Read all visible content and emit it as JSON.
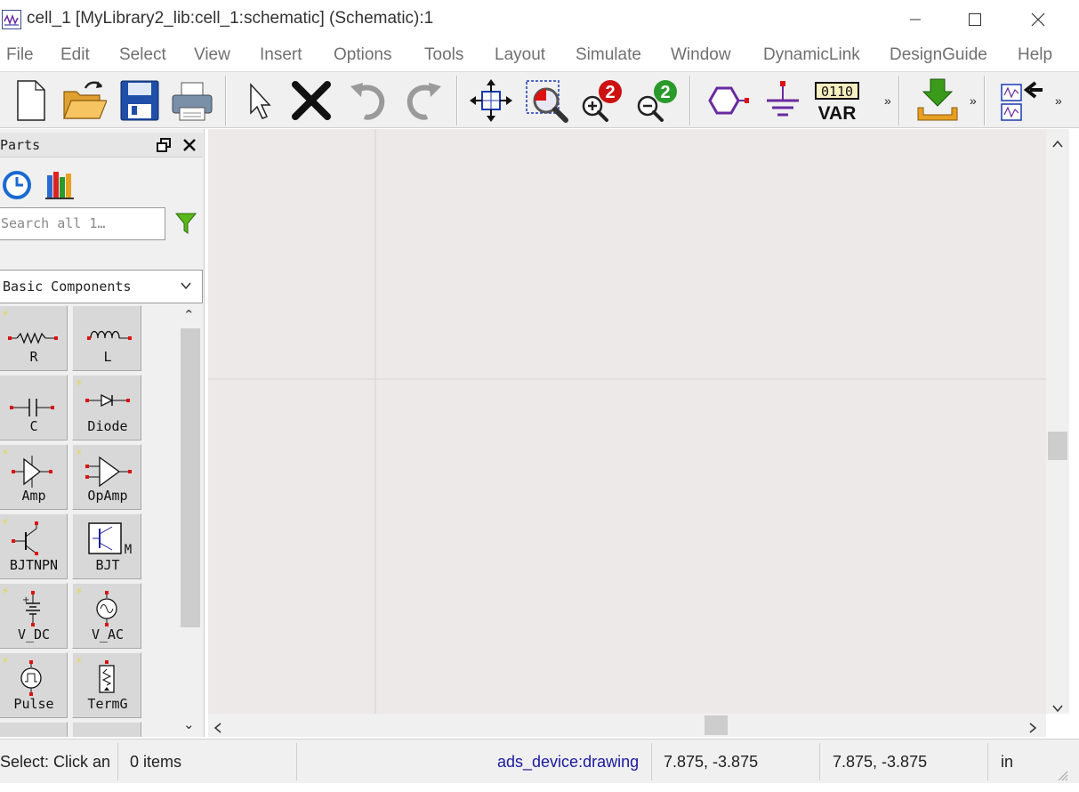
{
  "window": {
    "title": "cell_1 [MyLibrary2_lib:cell_1:schematic] (Schematic):1",
    "controls": [
      "minimize",
      "maximize",
      "close"
    ]
  },
  "menu": [
    "File",
    "Edit",
    "Select",
    "View",
    "Insert",
    "Options",
    "Tools",
    "Layout",
    "Simulate",
    "Window",
    "DynamicLink",
    "DesignGuide",
    "Help"
  ],
  "toolbar": {
    "buttons": [
      "new-document-icon",
      "open-folder-icon",
      "save-icon",
      "print-icon",
      "select-pointer-icon",
      "delete-icon",
      "undo-icon",
      "redo-icon",
      "pan-view-icon",
      "zoom-area-icon",
      "zoom-in-icon",
      "zoom-out-icon",
      "port-icon",
      "ground-icon",
      "var-icon",
      "simulate-icon",
      "component-palette-icon"
    ],
    "var_top": "0110",
    "var_bottom": "VAR",
    "zoom_in_digit": "2",
    "zoom_out_digit": "2",
    "colors": {
      "port": "#6a2aa0",
      "ground": "#6a2aa0",
      "simulate": "#3a8a1a",
      "zoom_badge": "#cc1111"
    }
  },
  "parts_panel": {
    "title": "Parts",
    "search_placeholder": "Search all 1…",
    "library": "Basic Components",
    "parts": [
      {
        "label": "R",
        "symbol": "resistor"
      },
      {
        "label": "L",
        "symbol": "inductor"
      },
      {
        "label": "C",
        "symbol": "capacitor"
      },
      {
        "label": "Diode",
        "symbol": "diode"
      },
      {
        "label": "Amp",
        "symbol": "amplifier"
      },
      {
        "label": "OpAmp",
        "symbol": "opamp"
      },
      {
        "label": "BJTNPN",
        "symbol": "bjt-npn"
      },
      {
        "label": "BJT",
        "symbol": "bjt-model"
      },
      {
        "label": "V_DC",
        "symbol": "dc-source"
      },
      {
        "label": "V_AC",
        "symbol": "ac-source"
      },
      {
        "label": "Pulse",
        "symbol": "pulse-source"
      },
      {
        "label": "TermG",
        "symbol": "term-g"
      }
    ]
  },
  "status": {
    "message": "Select: Click an",
    "items": "0 items",
    "layer": "ads_device:drawing",
    "coord1": "7.875, -3.875",
    "coord2": "7.875, -3.875",
    "units": "in",
    "layer_color": "#1a1aa0"
  }
}
